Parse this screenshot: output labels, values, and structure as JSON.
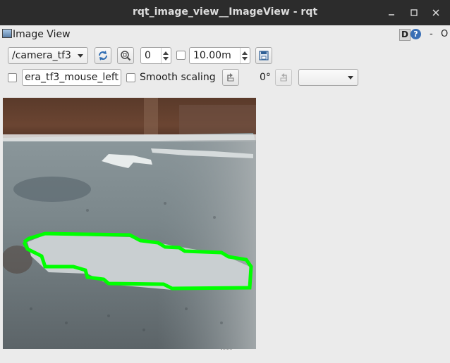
{
  "window": {
    "title": "rqt_image_view__ImageView - rqt",
    "minimize_glyph": "_",
    "maximize_glyph": "□",
    "close_glyph": "×"
  },
  "plugin": {
    "title": "Image View",
    "icon": "image-view-icon",
    "d_button_label": "D",
    "help_label": "?",
    "dash_label": "-",
    "o_label": "O"
  },
  "toolbar": {
    "topic": "/camera_tf3",
    "refresh_icon": "refresh-icon",
    "zoom_icon": "zoom-fit-icon",
    "spin_value": "0",
    "max_range_value": "10.00m",
    "save_icon": "save-icon"
  },
  "toolbar2": {
    "mouse_topic": "era_tf3_mouse_left",
    "smooth_scaling_label": "Smooth scaling",
    "rotate_left_icon": "rotate-left-icon",
    "rotation_label": "0°",
    "rotate_right_icon": "rotate-right-icon",
    "color_scheme_value": ""
  },
  "colors": {
    "overlay_contour": "#00ff00",
    "title_bar": "#2c2c2c",
    "panel": "#ebebeb"
  }
}
